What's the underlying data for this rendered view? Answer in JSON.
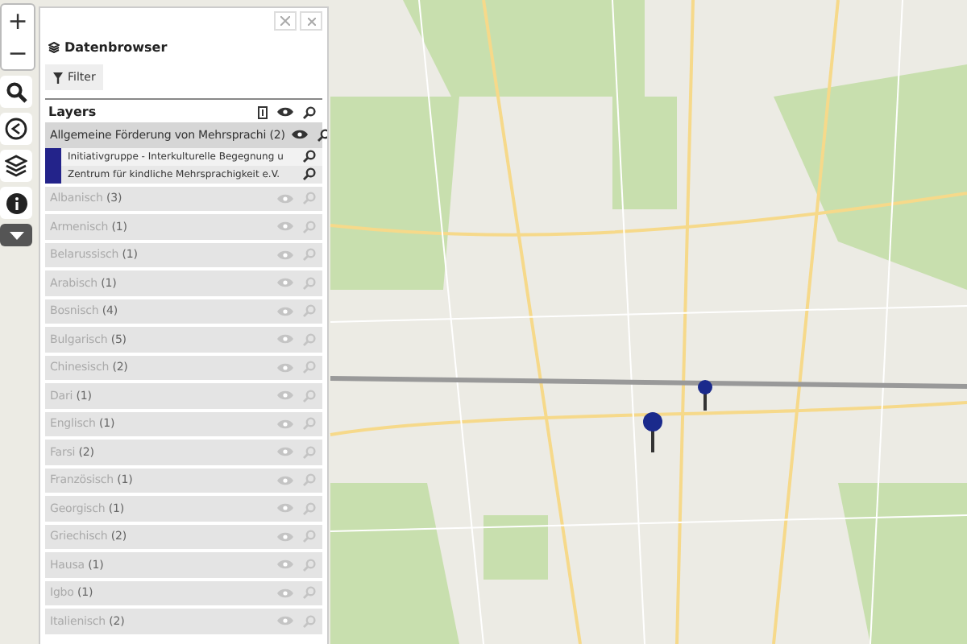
{
  "zoom_controls": [
    "+",
    "−"
  ],
  "panel": {
    "title": "Datenbrowser",
    "filter_button": "Filter",
    "layers_heading": "Layers",
    "layers": [
      {
        "name": "Allgemeine Förderung von Mehrsprachi",
        "count": "(2)",
        "enabled": true,
        "expanded": true,
        "children": [
          {
            "name": "Initiativgruppe - Interkulturelle Begegnung u",
            "color": "#23238a"
          },
          {
            "name": "Zentrum für kindliche Mehrsprachigkeit e.V.",
            "color": "#23238a"
          }
        ]
      },
      {
        "name": "Albanisch",
        "count": "(3)",
        "enabled": false,
        "expanded": false
      },
      {
        "name": "Armenisch",
        "count": "(1)",
        "enabled": false,
        "expanded": false
      },
      {
        "name": "Belarussisch",
        "count": "(1)",
        "enabled": false,
        "expanded": false
      },
      {
        "name": "Arabisch",
        "count": "(1)",
        "enabled": false,
        "expanded": false
      },
      {
        "name": "Bosnisch",
        "count": "(4)",
        "enabled": false,
        "expanded": false
      },
      {
        "name": "Bulgarisch",
        "count": "(5)",
        "enabled": false,
        "expanded": false
      },
      {
        "name": "Chinesisch",
        "count": "(2)",
        "enabled": false,
        "expanded": false
      },
      {
        "name": "Dari",
        "count": "(1)",
        "enabled": false,
        "expanded": false
      },
      {
        "name": "Englisch",
        "count": "(1)",
        "enabled": false,
        "expanded": false
      },
      {
        "name": "Farsi",
        "count": "(2)",
        "enabled": false,
        "expanded": false
      },
      {
        "name": "Französisch",
        "count": "(1)",
        "enabled": false,
        "expanded": false
      },
      {
        "name": "Georgisch",
        "count": "(1)",
        "enabled": false,
        "expanded": false
      },
      {
        "name": "Griechisch",
        "count": "(2)",
        "enabled": false,
        "expanded": false
      },
      {
        "name": "Hausa",
        "count": "(1)",
        "enabled": false,
        "expanded": false
      },
      {
        "name": "Igbo",
        "count": "(1)",
        "enabled": false,
        "expanded": false
      },
      {
        "name": "Italienisch",
        "count": "(2)",
        "enabled": false,
        "expanded": false
      }
    ]
  }
}
